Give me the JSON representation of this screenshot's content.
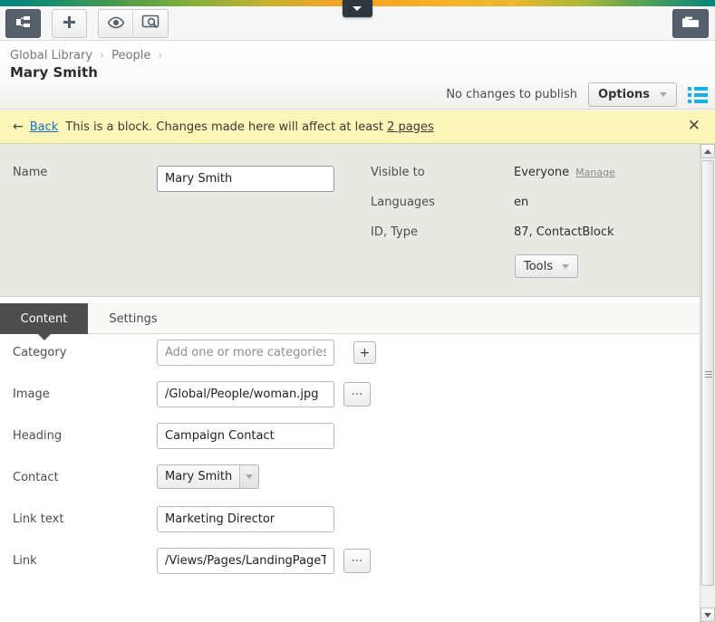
{
  "chrome": {
    "center_tab_icon": "chevron-down-icon",
    "toolbar": {
      "tree_toggle_icon": "sitemap-icon",
      "add_label": "+",
      "preview_icon": "eye-icon",
      "inspect_icon": "screen-search-icon",
      "assets_icon": "folder-icon"
    }
  },
  "header": {
    "breadcrumb": [
      {
        "label": "Global Library"
      },
      {
        "label": "People"
      }
    ],
    "breadcrumb_separator": "›",
    "title": "Mary Smith",
    "publish_status": "No changes to publish",
    "options_label": "Options",
    "options_caret_icon": "chevron-down-icon",
    "list_view_icon": "list-view-icon",
    "accent_blue": "#16b0e8"
  },
  "notice": {
    "back_arrow_icon": "arrow-left-icon",
    "back_label": "Back",
    "text_before": "This is a block. Changes made here will affect at least ",
    "link_label": "2 pages",
    "close_icon": "close-icon",
    "background": "#fcf5b8"
  },
  "properties": {
    "name_label": "Name",
    "name_value": "Mary Smith",
    "rows": [
      {
        "label": "Visible to",
        "value": "Everyone",
        "action": "Manage"
      },
      {
        "label": "Languages",
        "value": "en"
      },
      {
        "label": "ID, Type",
        "value": "87, ContactBlock"
      }
    ],
    "tools_label": "Tools",
    "tools_caret_icon": "chevron-down-icon"
  },
  "tabs": [
    {
      "label": "Content",
      "active": true
    },
    {
      "label": "Settings",
      "active": false
    }
  ],
  "form": {
    "fields": [
      {
        "label": "Category",
        "value": "",
        "placeholder": "Add one or more categories",
        "control": "text",
        "button": "+",
        "button_name": "add-category-button"
      },
      {
        "label": "Image",
        "value": "/Global/People/woman.jpg",
        "placeholder": "",
        "control": "text",
        "button": "...",
        "button_name": "browse-image-button"
      },
      {
        "label": "Heading",
        "value": "Campaign Contact",
        "placeholder": "",
        "control": "text",
        "button": "",
        "button_name": ""
      },
      {
        "label": "Contact",
        "value": "Mary Smith",
        "placeholder": "",
        "control": "select",
        "button": "",
        "button_name": ""
      },
      {
        "label": "Link text",
        "value": "Marketing Director",
        "placeholder": "",
        "control": "text",
        "button": "",
        "button_name": ""
      },
      {
        "label": "Link",
        "value": "/Views/Pages/LandingPageT",
        "placeholder": "",
        "control": "text",
        "button": "...",
        "button_name": "browse-link-button"
      }
    ]
  },
  "scrollbar": {
    "up_icon": "triangle-up-icon",
    "down_icon": "triangle-down-icon"
  }
}
